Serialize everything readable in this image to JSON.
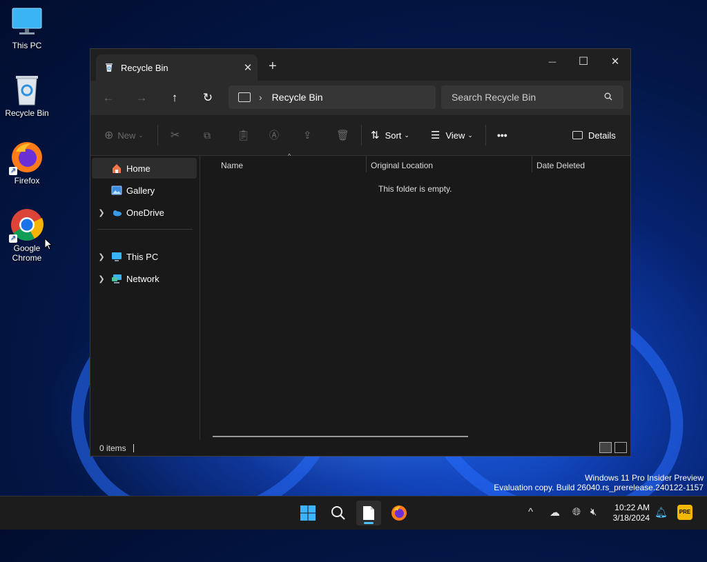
{
  "desktop": {
    "icons": [
      {
        "label": "This PC"
      },
      {
        "label": "Recycle Bin"
      },
      {
        "label": "Firefox"
      },
      {
        "label": "Google Chrome"
      }
    ]
  },
  "window": {
    "tab_title": "Recycle Bin",
    "new_tab_symbol": "+",
    "controls": {
      "minimize": "—",
      "maximize": "☐",
      "close": "✕"
    },
    "address": {
      "breadcrumb": "Recycle Bin",
      "search_placeholder": "Search Recycle Bin"
    },
    "toolbar": {
      "new_label": "New",
      "sort_label": "Sort",
      "view_label": "View",
      "more_label": "•••",
      "details_label": "Details"
    },
    "sidebar": {
      "items": [
        {
          "label": "Home"
        },
        {
          "label": "Gallery"
        },
        {
          "label": "OneDrive"
        },
        {
          "label": "This PC"
        },
        {
          "label": "Network"
        }
      ]
    },
    "columns": [
      "Name",
      "Original Location",
      "Date Deleted"
    ],
    "empty_message": "This folder is empty.",
    "status": {
      "item_count": "0 items"
    }
  },
  "watermark": {
    "line1": "Windows 11 Pro Insider Preview",
    "line2": "Evaluation copy. Build 26040.rs_prerelease.240122-1157"
  },
  "taskbar": {
    "clock_time": "10:22 AM",
    "clock_date": "3/18/2024"
  },
  "colors": {
    "accent": "#4cc2ff",
    "window_bg": "#191919",
    "taskbar_bg": "#1c1c1c"
  }
}
